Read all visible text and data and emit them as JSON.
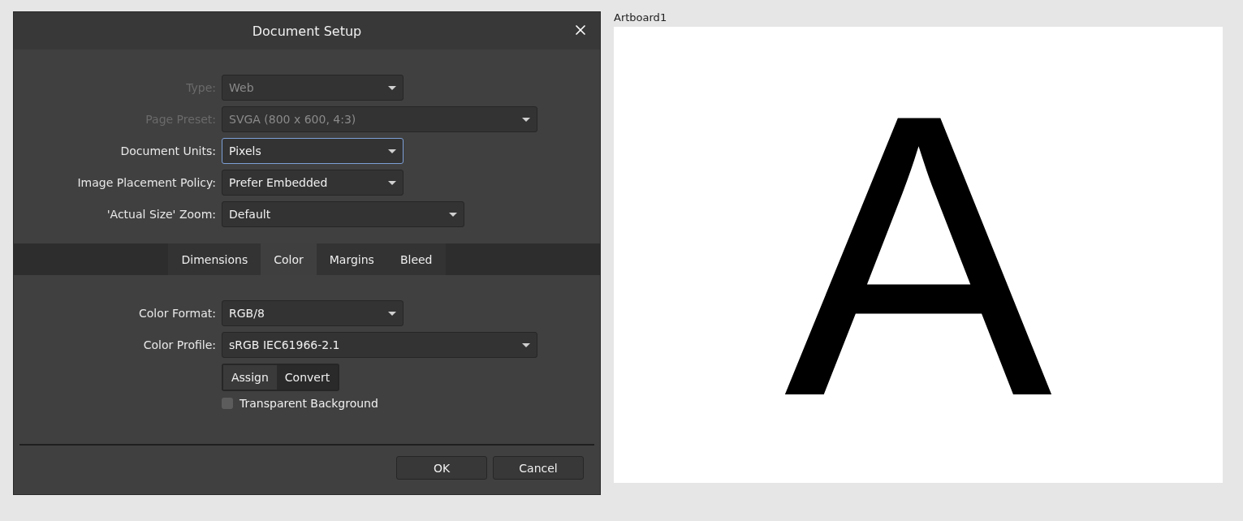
{
  "dialog": {
    "title": "Document Setup",
    "fields": [
      {
        "label": "Type:",
        "value": "Web",
        "disabled": true,
        "focused": false
      },
      {
        "label": "Page Preset:",
        "value": "SVGA  (800 x 600, 4:3)",
        "disabled": true,
        "focused": false
      },
      {
        "label": "Document Units:",
        "value": "Pixels",
        "disabled": false,
        "focused": true
      },
      {
        "label": "Image Placement Policy:",
        "value": "Prefer Embedded",
        "disabled": false,
        "focused": false
      },
      {
        "label": "'Actual Size' Zoom:",
        "value": "Default",
        "disabled": false,
        "focused": false
      }
    ],
    "tabs": [
      {
        "label": "Dimensions",
        "selected": false
      },
      {
        "label": "Color",
        "selected": true
      },
      {
        "label": "Margins",
        "selected": false
      },
      {
        "label": "Bleed",
        "selected": false
      }
    ],
    "color_fields": [
      {
        "label": "Color Format:",
        "value": "RGB/8",
        "disabled": false,
        "focused": false
      },
      {
        "label": "Color Profile:",
        "value": "sRGB IEC61966-2.1",
        "disabled": false,
        "focused": false
      }
    ],
    "profile_actions": [
      {
        "label": "Assign",
        "selected": true
      },
      {
        "label": "Convert",
        "selected": false
      }
    ],
    "transparent_background": {
      "label": "Transparent Background",
      "checked": false
    },
    "buttons": [
      "OK",
      "Cancel"
    ]
  },
  "artboard": {
    "label": "Artboard1",
    "text": "A"
  }
}
